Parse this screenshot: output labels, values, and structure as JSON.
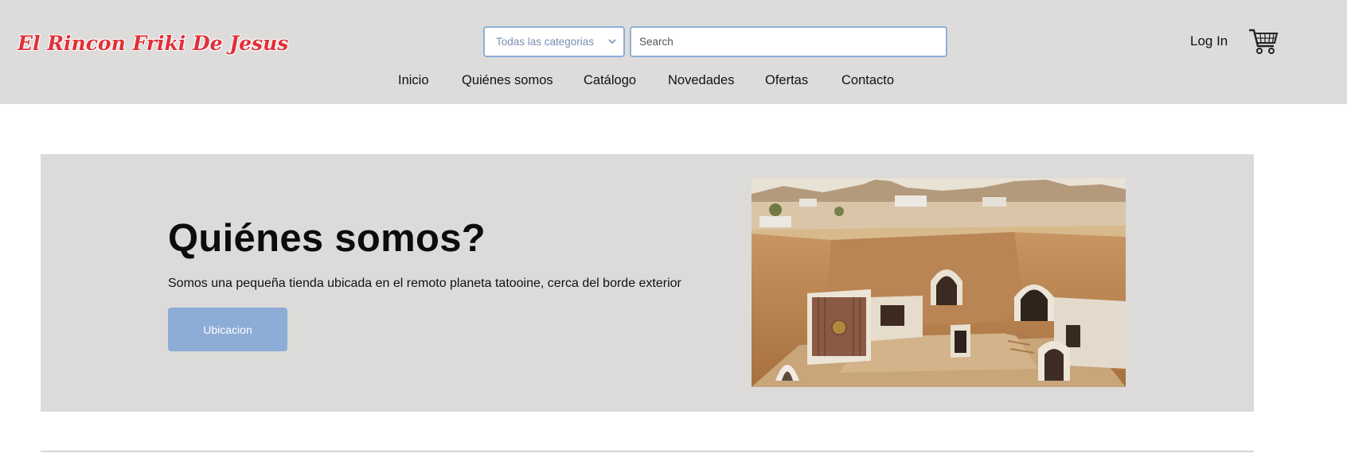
{
  "header": {
    "logo_text": "El Rincon Friki De Jesus",
    "category_select": {
      "selected": "Todas las categorias",
      "icon": "chevron-down-icon"
    },
    "search": {
      "placeholder": "Search",
      "value": ""
    },
    "login_label": "Log In",
    "cart_icon": "shopping-cart-icon"
  },
  "nav": {
    "items": [
      {
        "label": "Inicio"
      },
      {
        "label": "Quiénes somos"
      },
      {
        "label": "Catálogo"
      },
      {
        "label": "Novedades"
      },
      {
        "label": "Ofertas"
      },
      {
        "label": "Contacto"
      }
    ]
  },
  "hero": {
    "title": "Quiénes somos?",
    "text": "Somos una pequeña tienda ubicada en el remoto planeta tatooine, cerca del borde exterior",
    "button_label": "Ubicacion"
  },
  "colors": {
    "header_bg": "#dddcdb",
    "logo": "#e0303a",
    "accent_border": "#8eaed7",
    "button_bg": "#8dacd6",
    "hero_bg": "#dcdbda"
  }
}
